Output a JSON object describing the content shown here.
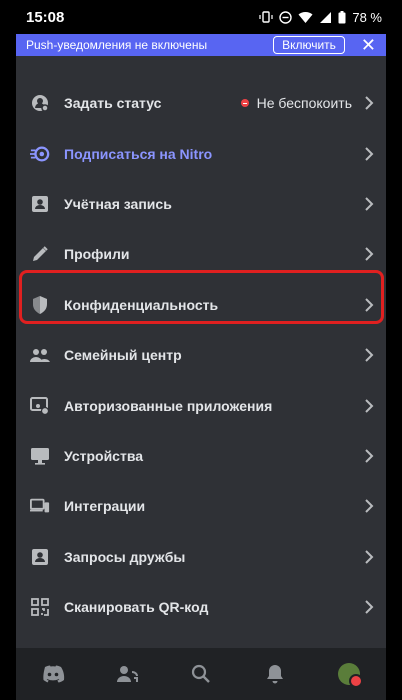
{
  "statusbar": {
    "time": "15:08",
    "battery": "78 %"
  },
  "banner": {
    "message": "Push-уведомления не включены",
    "enable_label": "Включить",
    "close_glyph": "✕"
  },
  "menu": [
    {
      "label": "Задать статус",
      "icon": "status-icon",
      "value": "Не беспокоить"
    },
    {
      "label": "Подписаться на Nitro",
      "icon": "nitro-icon"
    },
    {
      "label": "Учётная запись",
      "icon": "account-icon"
    },
    {
      "label": "Профили",
      "icon": "pencil-icon"
    },
    {
      "label": "Конфиденциальность",
      "icon": "shield-icon"
    },
    {
      "label": "Семейный центр",
      "icon": "family-icon"
    },
    {
      "label": "Авторизованные приложения",
      "icon": "apps-icon"
    },
    {
      "label": "Устройства",
      "icon": "monitor-icon"
    },
    {
      "label": "Интеграции",
      "icon": "devices-icon"
    },
    {
      "label": "Запросы дружбы",
      "icon": "friend-request-icon"
    },
    {
      "label": "Сканировать QR-код",
      "icon": "qr-icon"
    }
  ],
  "colors": {
    "background": "#2f3136",
    "accent": "#5865f2",
    "nitro": "#8b95ff",
    "highlight": "#e02020",
    "dnd": "#ed4245"
  }
}
